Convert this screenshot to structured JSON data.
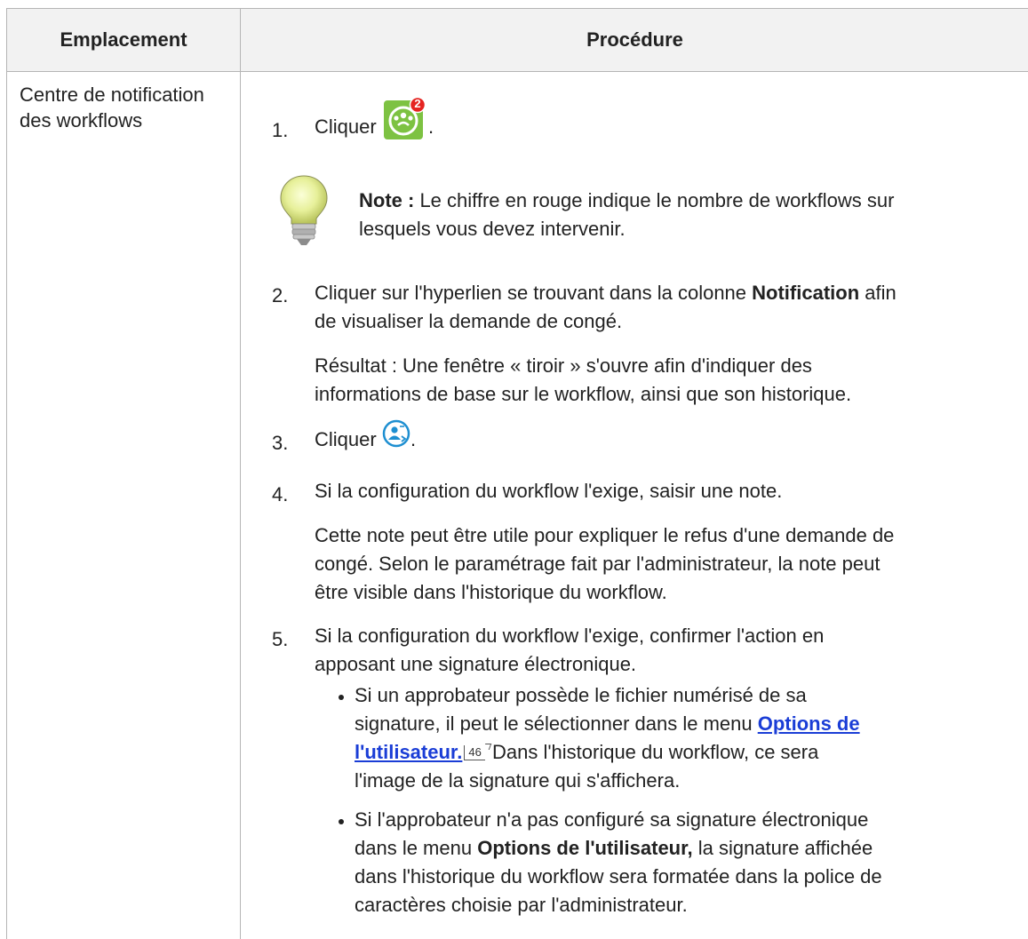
{
  "table": {
    "header_location": "Emplacement",
    "header_procedure": "Procédure",
    "location_line1": "Centre de notification",
    "location_line2": "des workflows"
  },
  "steps": {
    "s1_num": "1.",
    "s1_text": "Cliquer",
    "s1_after": ".",
    "notification_badge": "2",
    "note_label": "Note :",
    "note_text_1": " Le chiffre en rouge indique le nombre de workflows sur",
    "note_text_2": "lesquels vous devez intervenir.",
    "s2_num": "2.",
    "s2_line1_a": "Cliquer sur l'hyperlien se trouvant dans la colonne ",
    "s2_line1_b": "Notification",
    "s2_line1_c": " afin",
    "s2_line2": "de visualiser la demande de congé.",
    "s2_result_1": "Résultat : Une fenêtre « tiroir » s'ouvre afin d'indiquer des",
    "s2_result_2": "informations de base sur le workflow, ainsi que son historique.",
    "s3_num": "3.",
    "s3_text": "Cliquer",
    "s3_after": ".",
    "s4_num": "4.",
    "s4_text": "Si la configuration du workflow l'exige, saisir une note.",
    "s4_p1": "Cette note peut être utile pour expliquer le refus d'une demande de",
    "s4_p2": "congé. Selon le paramétrage fait par l'administrateur, la note peut",
    "s4_p3": "être visible dans l'historique du workflow.",
    "s5_num": "5.",
    "s5_line1": "Si la configuration du workflow l'exige, confirmer l'action en",
    "s5_line2": "apposant une signature électronique.",
    "b1_line1": "Si un approbateur possède le fichier numérisé de sa",
    "b1_line2a": "signature, il peut le sélectionner dans le menu ",
    "b1_link_1": "Options de",
    "b1_link_2": "l'utilisateur.",
    "b1_pageref": "46",
    "b1_line3b": " Dans l'historique du workflow, ce sera",
    "b1_line4": "l'image de la signature qui s'affichera.",
    "b2_line1": "Si l'approbateur n'a pas configuré sa signature électronique",
    "b2_line2a": "dans le menu ",
    "b2_line2b": "Options de l'utilisateur,",
    "b2_line2c": " la signature affichée",
    "b2_line3": "dans l'historique du workflow sera formatée dans la police de",
    "b2_line4": "caractères choisie par l'administrateur."
  },
  "icons": {
    "workflow_icon": "workflow-notification-icon",
    "reject_icon": "user-action-icon",
    "note_icon": "lightbulb-icon"
  },
  "colors": {
    "link": "#1a3dd6",
    "workflow_icon_bg": "#7dc242",
    "badge": "#e52421",
    "action_icon": "#1e8fd1"
  }
}
